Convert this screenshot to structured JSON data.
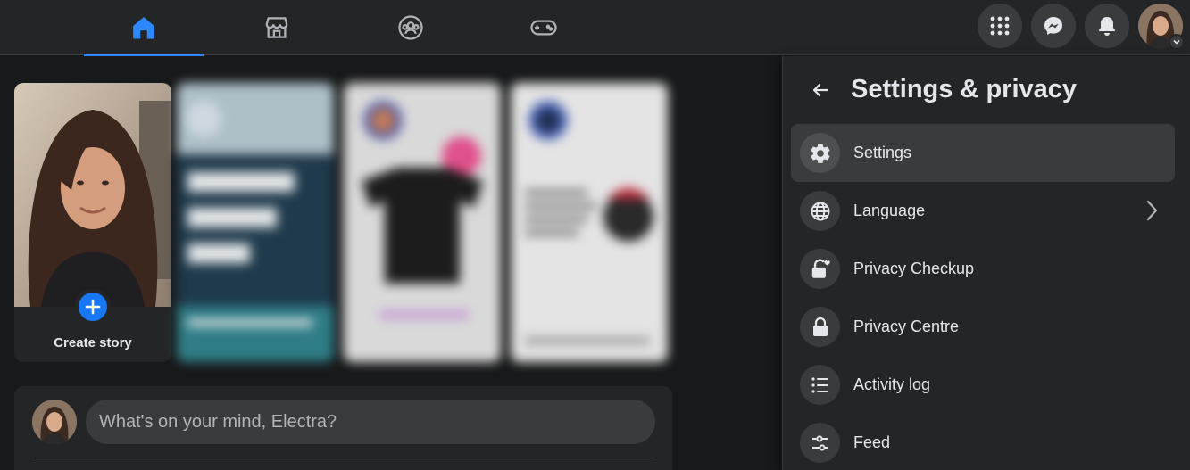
{
  "topbar": {
    "tabs": [
      {
        "icon": "home-icon",
        "active": true
      },
      {
        "icon": "marketplace-icon",
        "active": false
      },
      {
        "icon": "groups-icon",
        "active": false
      },
      {
        "icon": "gaming-icon",
        "active": false
      }
    ],
    "actions": [
      "menu-grid-icon",
      "messenger-icon",
      "notifications-icon"
    ],
    "accent": "#2d88ff"
  },
  "stories": {
    "create_label": "Create story"
  },
  "composer": {
    "placeholder": "What's on your mind, Electra?"
  },
  "settings_panel": {
    "title": "Settings & privacy",
    "items": [
      {
        "label": "Settings",
        "icon": "gear-icon"
      },
      {
        "label": "Language",
        "icon": "globe-icon",
        "has_submenu": true
      },
      {
        "label": "Privacy Checkup",
        "icon": "lock-heart-icon"
      },
      {
        "label": "Privacy Centre",
        "icon": "lock-icon"
      },
      {
        "label": "Activity log",
        "icon": "list-icon"
      },
      {
        "label": "Feed",
        "icon": "sliders-icon"
      }
    ]
  },
  "colors": {
    "background": "#18191a",
    "surface": "#242526",
    "hover": "#3a3b3c",
    "brand_blue": "#1877f2"
  }
}
